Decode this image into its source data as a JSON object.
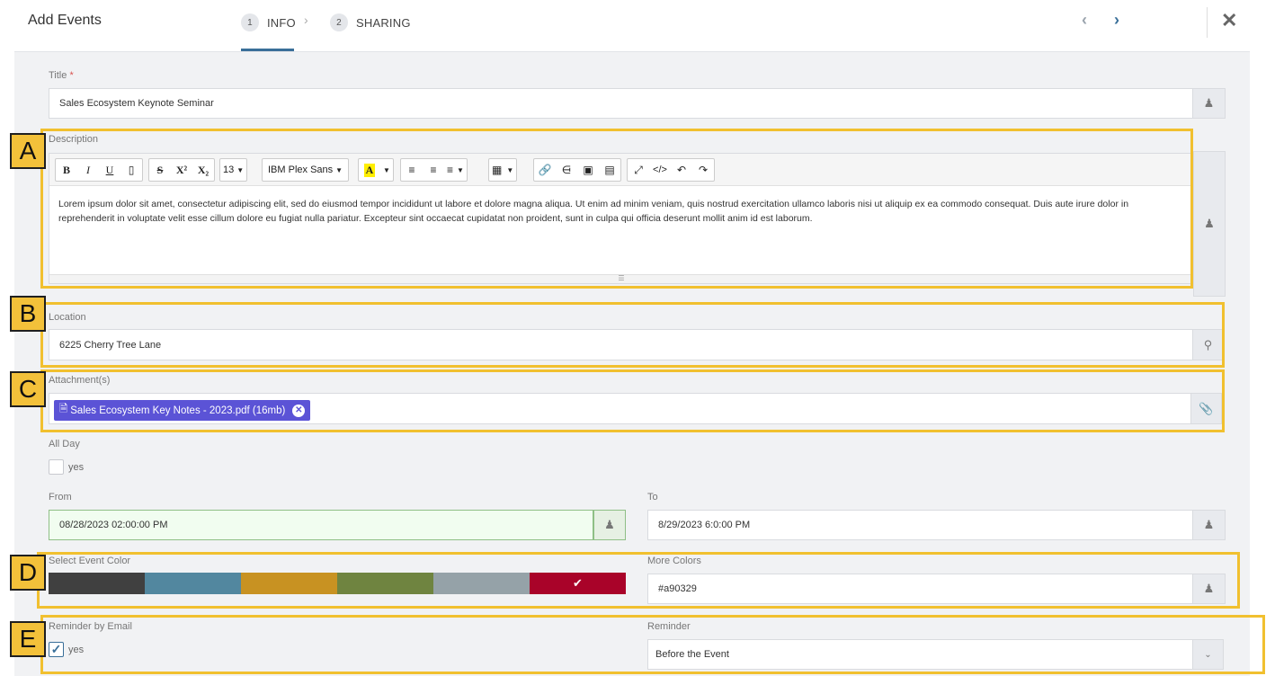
{
  "header": {
    "title": "Add Events",
    "steps": [
      {
        "num": "1",
        "label": "INFO"
      },
      {
        "num": "2",
        "label": "SHARING"
      }
    ],
    "close_icon": "close-icon",
    "prev_icon": "chevron-left-icon",
    "next_icon": "chevron-right-icon"
  },
  "title_field": {
    "label": "Title",
    "required_mark": "*",
    "value": "Sales Ecosystem Keynote Seminar"
  },
  "description": {
    "label": "Description",
    "toolbar": {
      "font_size": "13",
      "font_family": "IBM Plex Sans",
      "highlight_letter": "A",
      "bold": "B",
      "italic": "I",
      "underline": "U",
      "strike": "S",
      "superscript": "X²",
      "subscript": "X₂",
      "code": "</>"
    },
    "text": "Lorem ipsum dolor sit amet, consectetur adipiscing elit, sed do eiusmod tempor incididunt ut labore et dolore magna aliqua. Ut enim ad minim veniam, quis nostrud exercitation ullamco laboris nisi ut aliquip ex ea commodo consequat. Duis aute irure dolor in reprehenderit in voluptate velit esse cillum dolore eu fugiat nulla pariatur. Excepteur sint occaecat cupidatat non proident, sunt in culpa qui officia deserunt mollit anim id est laborum."
  },
  "location": {
    "label": "Location",
    "value": "6225 Cherry Tree Lane",
    "icon": "map-pin-icon"
  },
  "attachments": {
    "label": "Attachment(s)",
    "file": "Sales Ecosystem Key Notes - 2023.pdf (16mb)",
    "icon": "paperclip-icon"
  },
  "all_day": {
    "label": "All Day",
    "option": "yes",
    "checked": false
  },
  "from": {
    "label": "From",
    "value": "08/28/2023 02:00:00 PM"
  },
  "to": {
    "label": "To",
    "value": "8/29/2023 6:0:00 PM"
  },
  "event_color": {
    "label": "Select Event Color",
    "swatches": [
      "#404040",
      "#52879f",
      "#c89222",
      "#6f8440",
      "#95a2a8",
      "#a90329"
    ],
    "selected": "#a90329"
  },
  "more_colors": {
    "label": "More Colors",
    "value": "#a90329"
  },
  "reminder_email": {
    "label": "Reminder by Email",
    "option": "yes",
    "checked": true
  },
  "reminder": {
    "label": "Reminder",
    "value": "Before the Event"
  },
  "annotations": [
    "A",
    "B",
    "C",
    "D",
    "E"
  ]
}
